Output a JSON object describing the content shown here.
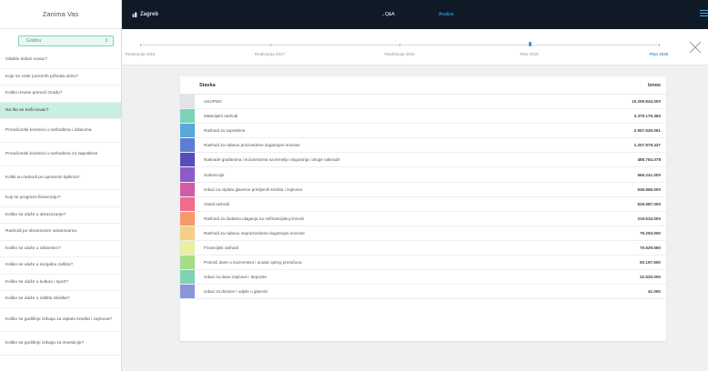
{
  "sidebar": {
    "title": "Zanima Vas",
    "select": {
      "value": "Godina",
      "chevron_icon": "chevron-up-down-icon"
    },
    "items": [
      {
        "label": "Odakle dolazi novac?",
        "active": false
      },
      {
        "label": "Koje se vrste porezníh prihoda ubiru?",
        "active": false
      },
      {
        "label": "Koliko iznose pomoći Gradu?",
        "active": false
      },
      {
        "label": "Na što se troši novac?",
        "active": true
      },
      {
        "label": "Proračunski korisnici u rashodima i izdacima",
        "active": false
      },
      {
        "label": "Proračunski korisnici u rashodima za zaposlene",
        "active": false
      },
      {
        "label": "Koliki su rashodi po upravnim tijelima?",
        "active": false
      },
      {
        "label": "Koji se programi financiraju?",
        "active": false
      },
      {
        "label": "Koliko se ulaže u obrazovanje?",
        "active": false
      },
      {
        "label": "Rashodi po obrazovnim ustanovama",
        "active": false
      },
      {
        "label": "Koliko se ulaže u zdravstvo?",
        "active": false
      },
      {
        "label": "Koliko se ulaže u socijalnu zaštitu?",
        "active": false
      },
      {
        "label": "Koliko se ulaže u kulturu i sport?",
        "active": false
      },
      {
        "label": "Koliko se ulaže u zaštitu okoliša?",
        "active": false
      },
      {
        "label": "Koliko se godišnje izdvaja za otplatu kredita i zajmova?",
        "active": false
      },
      {
        "label": "Koliko se godišnje izdvaja za investicije?",
        "active": false
      }
    ]
  },
  "topbar": {
    "home_label": "Zagreb",
    "home_icon": "city-icon",
    "qa_label": "→Q&A",
    "analiza_label": "Analiza",
    "menu_icon": "hamburger-menu-icon",
    "colors": {
      "background": "#101a27",
      "accent": "#3bb0ee"
    }
  },
  "timeline": {
    "points": [
      {
        "label": "Realizacija 2016",
        "current": false
      },
      {
        "label": "Realizacija 2017",
        "current": false
      },
      {
        "label": "Realizacija 2018",
        "current": false
      },
      {
        "label": "Plan 2019",
        "current": false
      },
      {
        "label": "Plan 2020",
        "current": true
      }
    ],
    "close_icon": "close-icon"
  },
  "table": {
    "headers": {
      "name": "Stavka",
      "value": "Iznos"
    },
    "rows": [
      {
        "name": "UKUPNO",
        "value": "10.209.844.000",
        "color": "#e2e3e5"
      },
      {
        "name": "Materijalni rashodi",
        "value": "3.379.176.364",
        "color": "#7fd1b8"
      },
      {
        "name": "Rashodi za zaposlene",
        "value": "2.957.636.061",
        "color": "#5aa8d8"
      },
      {
        "name": "Rashodi za nabavu proizvedene dugotrajne imovine",
        "value": "1.207.878.437",
        "color": "#5b7fd4"
      },
      {
        "name": "Naknade građanima i kućanstvima na temelju osiguranja i druge naknade",
        "value": "486.784.078",
        "color": "#5a4bbd"
      },
      {
        "name": "Subvencije",
        "value": "566.241.000",
        "color": "#8c5cc8"
      },
      {
        "name": "Izdaci za otplatu glavnice primljenih kredita i zajmova",
        "value": "546.966.000",
        "color": "#d35aa8"
      },
      {
        "name": "Ostali rashodi",
        "value": "526.987.000",
        "color": "#f06b8d"
      },
      {
        "name": "Rashodi za dodatna ulaganja na nefinancijskoj imovini",
        "value": "219.534.000",
        "color": "#f5996a"
      },
      {
        "name": "Rashodi za nabavu neproizvedene dugotrajne imovine",
        "value": "79.293.000",
        "color": "#f4cf86"
      },
      {
        "name": "Financijski rashodi",
        "value": "70.629.560",
        "color": "#e8ef9e"
      },
      {
        "name": "Pomoći dane u inozemstvo i unutar općeg proračuna",
        "value": "50.197.500",
        "color": "#a4dd85"
      },
      {
        "name": "Izdaci za dane zajmove i depozite",
        "value": "22.520.000",
        "color": "#7fd1b8"
      },
      {
        "name": "Izdaci za dionice i udjele u glavnici",
        "value": "41.000",
        "color": "#8a96d8"
      }
    ]
  }
}
